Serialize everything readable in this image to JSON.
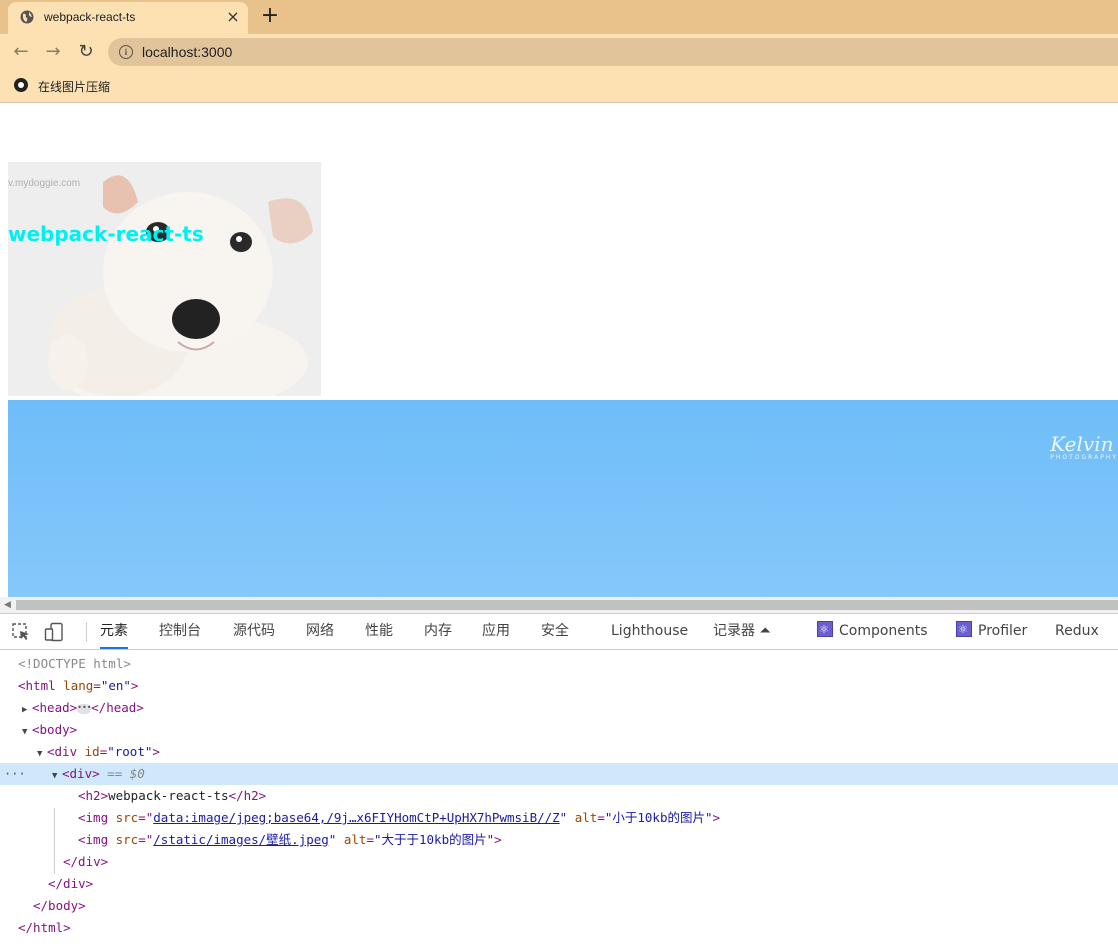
{
  "browser": {
    "tab": {
      "title": "webpack-react-ts",
      "favicon": "globe-icon",
      "close": "×"
    },
    "new_tab": "+",
    "nav": {
      "back": "←",
      "forward": "→",
      "reload": "↻"
    },
    "address": {
      "info_icon": "info-icon",
      "info_glyph": "i",
      "url": "localhost:3000"
    },
    "bookmarks": [
      {
        "label": "在线图片压缩",
        "icon": "record-icon"
      }
    ]
  },
  "page": {
    "heading": "webpack-react-ts",
    "small_image": {
      "alt": "小于10kb的图片",
      "watermark": "v.mydoggie.com"
    },
    "large_image": {
      "alt": "大于于10kb的图片",
      "watermark": "Kelvin",
      "watermark_sub": "PHOTOGRAPHY"
    }
  },
  "devtools": {
    "tabs": [
      {
        "label": "元素",
        "active": true
      },
      {
        "label": "控制台"
      },
      {
        "label": "源代码"
      },
      {
        "label": "网络"
      },
      {
        "label": "性能"
      },
      {
        "label": "内存"
      },
      {
        "label": "应用"
      },
      {
        "label": "安全"
      },
      {
        "label": "Lighthouse"
      },
      {
        "label": "记录器 ⏶"
      },
      {
        "label": "Components"
      },
      {
        "label": "Profiler"
      },
      {
        "label": "Redux"
      }
    ],
    "dom": {
      "doctype": "<!DOCTYPE html>",
      "html_open": "<html",
      "lang_attr": " lang",
      "lang_val": "\"en\"",
      "gt": ">",
      "head_open": "<head>",
      "head_close": "</head>",
      "body_open": "<body>",
      "div_root_open": "<div",
      "id_attr": " id",
      "id_val": "\"root\"",
      "div_open": "<div>",
      "sel_marker": " == $0",
      "h2_open": "<h2>",
      "h2_text": "webpack-react-ts",
      "h2_close": "</h2>",
      "img_open": "<img",
      "src_attr": " src",
      "eq_quote": "=\"",
      "img1_src": "data:image/jpeg;base64,/9j…x6FIYHomCtP+UpHX7hPwmsiB//Z",
      "img2_src": "/static/images/壁纸.jpeg",
      "quote": "\"",
      "alt_attr": " alt",
      "img1_alt": "\"小于10kb的图片\"",
      "img2_alt": "\"大于于10kb的图片\"",
      "div_close": "</div>",
      "body_close": "</body>",
      "html_close": "</html>",
      "ellipsis": "···"
    }
  }
}
